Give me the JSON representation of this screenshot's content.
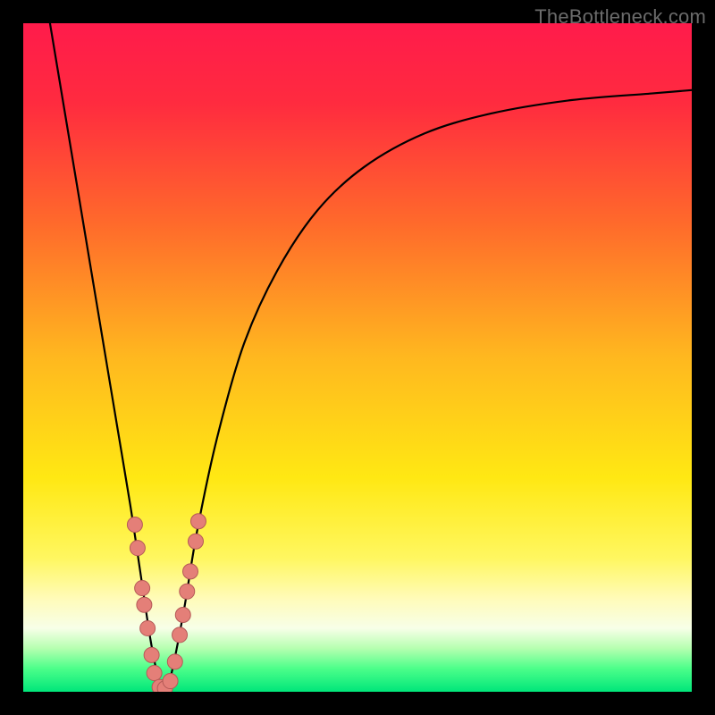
{
  "watermark": "TheBottleneck.com",
  "chart_data": {
    "type": "line",
    "title": "",
    "xlabel": "",
    "ylabel": "",
    "xlim": [
      0,
      100
    ],
    "ylim": [
      0,
      100
    ],
    "gradient_stops": [
      {
        "pos": 0.0,
        "color": "#ff1b4b"
      },
      {
        "pos": 0.12,
        "color": "#ff2b3f"
      },
      {
        "pos": 0.3,
        "color": "#ff6a2b"
      },
      {
        "pos": 0.5,
        "color": "#ffb81f"
      },
      {
        "pos": 0.68,
        "color": "#ffe813"
      },
      {
        "pos": 0.8,
        "color": "#fff760"
      },
      {
        "pos": 0.86,
        "color": "#fffbb8"
      },
      {
        "pos": 0.905,
        "color": "#f7ffe8"
      },
      {
        "pos": 0.935,
        "color": "#b6ffb0"
      },
      {
        "pos": 0.965,
        "color": "#4dff8a"
      },
      {
        "pos": 1.0,
        "color": "#00e67a"
      }
    ],
    "series": [
      {
        "name": "curve",
        "x": [
          4.0,
          6.0,
          8.0,
          10.0,
          12.0,
          14.0,
          16.0,
          17.5,
          19.0,
          20.2,
          21.0,
          22.0,
          24.0,
          26.0,
          29.0,
          33.0,
          38.0,
          44.0,
          51.0,
          60.0,
          70.0,
          82.0,
          94.0,
          100.0
        ],
        "y": [
          100.0,
          88.0,
          76.0,
          64.0,
          52.0,
          40.0,
          28.0,
          18.0,
          8.0,
          2.0,
          0.0,
          2.0,
          12.0,
          24.0,
          38.0,
          52.0,
          63.0,
          72.0,
          78.5,
          83.5,
          86.5,
          88.5,
          89.5,
          90.0
        ]
      }
    ],
    "markers": [
      {
        "x": 16.7,
        "y": 25.0
      },
      {
        "x": 17.1,
        "y": 21.5
      },
      {
        "x": 17.8,
        "y": 15.5
      },
      {
        "x": 18.1,
        "y": 13.0
      },
      {
        "x": 18.6,
        "y": 9.5
      },
      {
        "x": 19.2,
        "y": 5.5
      },
      {
        "x": 19.6,
        "y": 2.8
      },
      {
        "x": 20.4,
        "y": 0.7
      },
      {
        "x": 21.2,
        "y": 0.5
      },
      {
        "x": 22.0,
        "y": 1.6
      },
      {
        "x": 22.7,
        "y": 4.5
      },
      {
        "x": 23.4,
        "y": 8.5
      },
      {
        "x": 23.9,
        "y": 11.5
      },
      {
        "x": 24.5,
        "y": 15.0
      },
      {
        "x": 25.0,
        "y": 18.0
      },
      {
        "x": 25.8,
        "y": 22.5
      },
      {
        "x": 26.2,
        "y": 25.5
      }
    ],
    "marker_style": {
      "r": 8.5,
      "fill": "#e47f78",
      "stroke": "#b55a57"
    }
  }
}
